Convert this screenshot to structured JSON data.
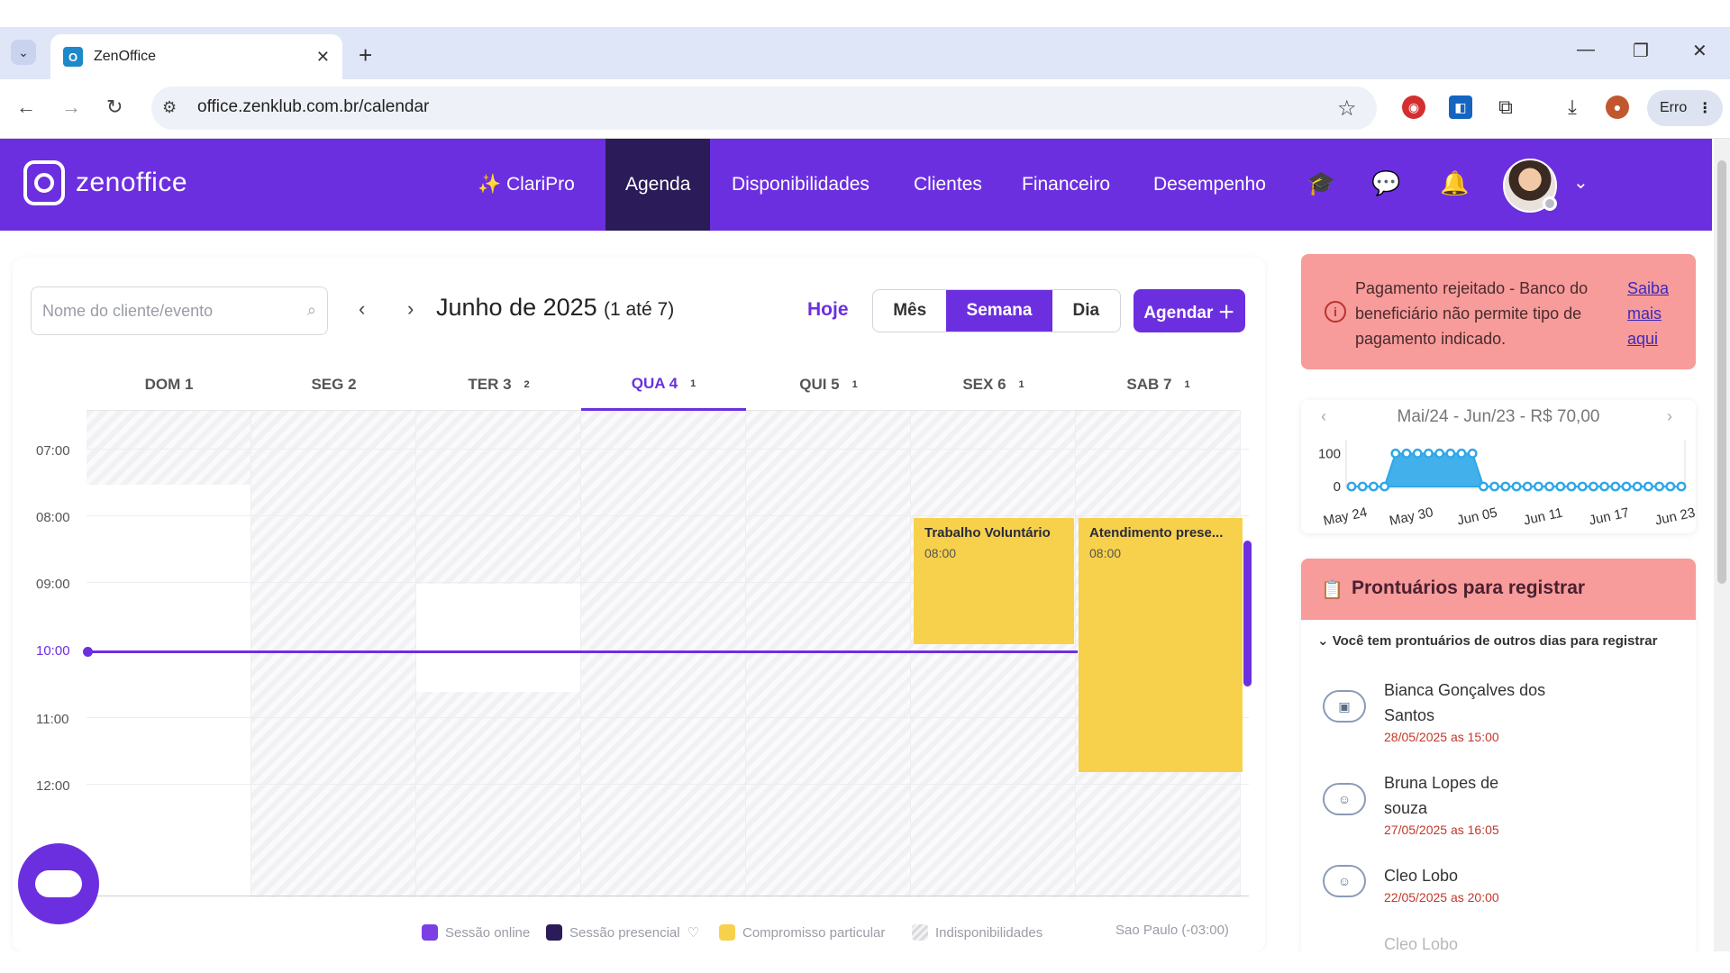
{
  "browser": {
    "tab_title": "ZenOffice",
    "url": "office.zenklub.com.br/calendar",
    "profile_chip": "Erro"
  },
  "app": {
    "logo_text": "zenoffice",
    "menu": [
      {
        "label": "✨ ClariPro"
      },
      {
        "label": "Agenda"
      },
      {
        "label": "Disponibilidades"
      },
      {
        "label": "Clientes"
      },
      {
        "label": "Financeiro"
      },
      {
        "label": "Desempenho"
      }
    ],
    "icons": [
      "graduation-cap-icon",
      "chat-icon",
      "bell-icon"
    ]
  },
  "calendar": {
    "search_placeholder": "Nome do cliente/evento",
    "period_title": "Junho de 2025",
    "period_range": "(1 até 7)",
    "today_label": "Hoje",
    "views": [
      "Mês",
      "Semana",
      "Dia"
    ],
    "selected_view": "Semana",
    "schedule_button": "Agendar ＋",
    "days": [
      {
        "label": "DOM 1",
        "count": ""
      },
      {
        "label": "SEG 2",
        "count": ""
      },
      {
        "label": "TER 3",
        "count": "2"
      },
      {
        "label": "QUA 4",
        "count": "1"
      },
      {
        "label": "QUI 5",
        "count": "1"
      },
      {
        "label": "SEX 6",
        "count": "1"
      },
      {
        "label": "SAB 7",
        "count": "1"
      }
    ],
    "hours": [
      "07:00",
      "08:00",
      "09:00",
      "10:00",
      "11:00",
      "12:00"
    ],
    "current_time": "10:00",
    "events": [
      {
        "title": "Trabalho Voluntário",
        "time": "08:00"
      },
      {
        "title": "Atendimento prese...",
        "time": "08:00"
      }
    ],
    "legend": [
      {
        "label": "Sessão online",
        "color": "#7b3fe4"
      },
      {
        "label": "Sessão presencial",
        "color": "#2b1b58"
      },
      {
        "label": "Compromisso particular",
        "color": "#f7d14c"
      },
      {
        "label": "Indisponibilidades",
        "color": "#e6e6ea"
      }
    ],
    "timezone": "Sao Paulo (-03:00)"
  },
  "alert": {
    "message": "Pagamento rejeitado - Banco do beneficiário não permite tipo de pagamento indicado.",
    "link": "Saiba mais aqui"
  },
  "earnings_chart": {
    "title": "Mai/24 - Jun/23 - R$ 70,00"
  },
  "chart_data": {
    "type": "area",
    "title": "Mai/24 - Jun/23 - R$ 70,00",
    "x_ticks": [
      "May 24",
      "May 30",
      "Jun 05",
      "Jun 11",
      "Jun 17",
      "Jun 23"
    ],
    "y_ticks": [
      "0",
      "100"
    ],
    "ylim": [
      0,
      120
    ],
    "series": [
      {
        "color": "#2ea7e8",
        "values": [
          0,
          0,
          0,
          0,
          100,
          100,
          100,
          100,
          100,
          100,
          100,
          100,
          0,
          0,
          0,
          0,
          0,
          0,
          0,
          0,
          0,
          0,
          0,
          0,
          0,
          0,
          0,
          0,
          0,
          0,
          0
        ]
      }
    ]
  },
  "prontuarios": {
    "title": "Prontuários para registrar",
    "subtitle": "Você tem prontuários de outros dias para registrar",
    "items": [
      {
        "name": "Bianca Gonçalves dos Santos",
        "date": "28/05/2025 as 15:00"
      },
      {
        "name": "Bruna Lopes de souza",
        "date": "27/05/2025 as 16:05"
      },
      {
        "name": "Cleo Lobo",
        "date": "22/05/2025 as 20:00"
      },
      {
        "name": "Cleo Lobo",
        "date": ""
      }
    ]
  }
}
